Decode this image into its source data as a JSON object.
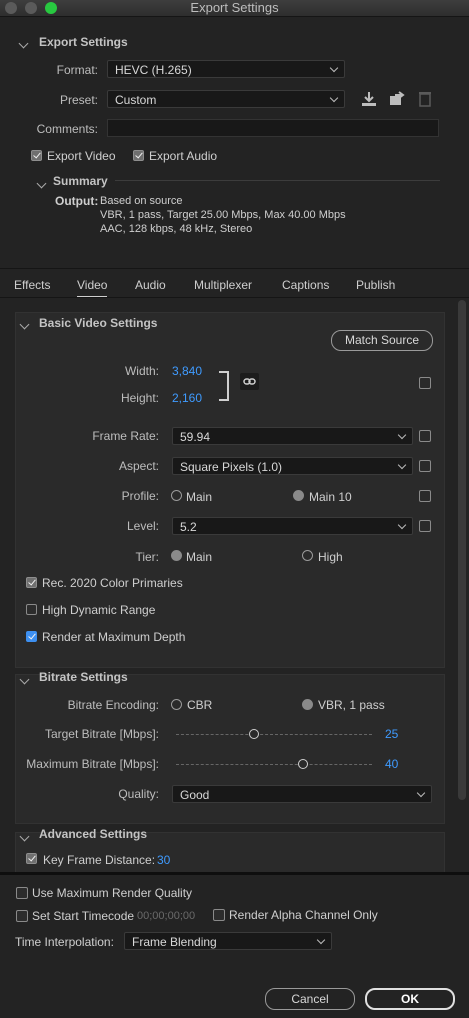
{
  "window": {
    "title": "Export Settings"
  },
  "export_settings": {
    "header": "Export Settings",
    "format_label": "Format:",
    "format_value": "HEVC (H.265)",
    "preset_label": "Preset:",
    "preset_value": "Custom",
    "comments_label": "Comments:",
    "comments_value": "",
    "export_video_label": "Export Video",
    "export_video_checked": true,
    "export_audio_label": "Export Audio",
    "export_audio_checked": true
  },
  "summary": {
    "header": "Summary",
    "output_label": "Output:",
    "output_lines": [
      "Based on source",
      "VBR, 1 pass, Target 25.00 Mbps, Max 40.00 Mbps",
      "AAC, 128 kbps, 48 kHz, Stereo"
    ]
  },
  "tabs": [
    "Effects",
    "Video",
    "Audio",
    "Multiplexer",
    "Captions",
    "Publish"
  ],
  "active_tab": "Video",
  "basic_video": {
    "header": "Basic Video Settings",
    "match_source_label": "Match Source",
    "width_label": "Width:",
    "width_value": "3,840",
    "height_label": "Height:",
    "height_value": "2,160",
    "frame_rate_label": "Frame Rate:",
    "frame_rate_value": "59.94",
    "aspect_label": "Aspect:",
    "aspect_value": "Square Pixels (1.0)",
    "profile_label": "Profile:",
    "profile_options": [
      "Main",
      "Main 10"
    ],
    "profile_selected": "Main 10",
    "level_label": "Level:",
    "level_value": "5.2",
    "tier_label": "Tier:",
    "tier_options": [
      "Main",
      "High"
    ],
    "tier_selected": "Main",
    "rec2020_label": "Rec. 2020 Color Primaries",
    "rec2020_checked": true,
    "hdr_label": "High Dynamic Range",
    "hdr_checked": false,
    "max_depth_label": "Render at Maximum Depth",
    "max_depth_checked": true
  },
  "bitrate": {
    "header": "Bitrate Settings",
    "encoding_label": "Bitrate Encoding:",
    "encoding_options": [
      "CBR",
      "VBR, 1 pass"
    ],
    "encoding_selected": "VBR, 1 pass",
    "target_label": "Target Bitrate [Mbps]:",
    "target_value": "25",
    "target_fraction": 0.4,
    "max_label": "Maximum Bitrate [Mbps]:",
    "max_value": "40",
    "max_fraction": 0.65,
    "quality_label": "Quality:",
    "quality_value": "Good"
  },
  "advanced": {
    "header": "Advanced Settings",
    "key_frame_label": "Key Frame Distance:",
    "key_frame_value": "30",
    "key_frame_checked": true
  },
  "footer": {
    "max_quality_label": "Use Maximum Render Quality",
    "set_start_tc_label": "Set Start Timecode",
    "start_tc_value": "00;00;00;00",
    "alpha_label": "Render Alpha Channel Only",
    "time_interp_label": "Time Interpolation:",
    "time_interp_value": "Frame Blending",
    "cancel_label": "Cancel",
    "ok_label": "OK"
  },
  "colors": {
    "accent_blue": "#3f9bff",
    "background": "#232323"
  }
}
